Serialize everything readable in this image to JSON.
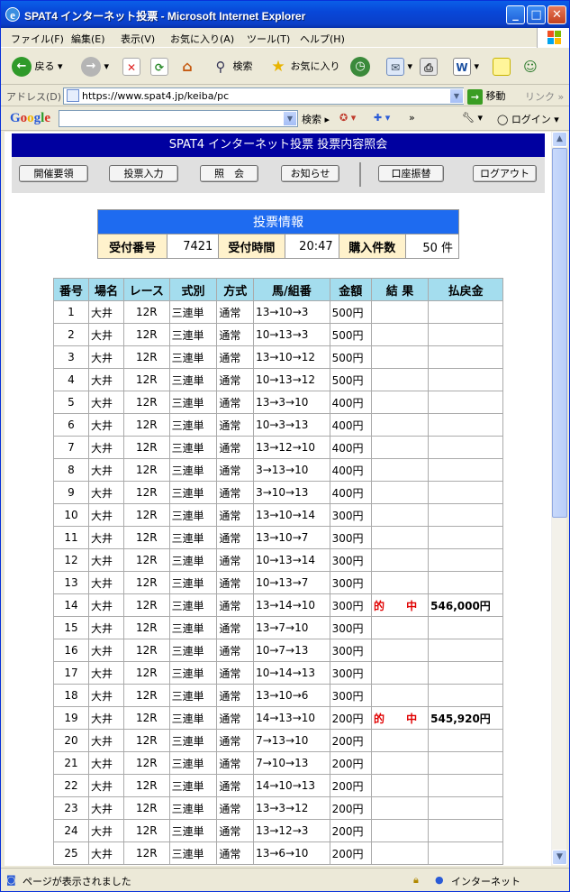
{
  "window": {
    "title": "SPAT4 インターネット投票 - Microsoft Internet Explorer"
  },
  "menu": [
    "ファイル(F)",
    "編集(E)",
    "表示(V)",
    "お気に入り(A)",
    "ツール(T)",
    "ヘルプ(H)"
  ],
  "toolbar": {
    "back": "戻る",
    "search": "検索",
    "favorites": "お気に入り"
  },
  "address": {
    "label": "アドレス(D)",
    "url": "https://www.spat4.jp/keiba/pc",
    "go": "移動",
    "links": "リンク"
  },
  "google": {
    "logo": "Google",
    "search": "検索",
    "login": "ログイン"
  },
  "page": {
    "header": "SPAT4 インターネット投票 投票内容照会",
    "nav": [
      "開催要領",
      "投票入力",
      "照　会",
      "お知らせ",
      "口座振替",
      "ログアウト"
    ]
  },
  "info": {
    "title": "投票情報",
    "receipt_label": "受付番号",
    "receipt_value": "7421",
    "time_label": "受付時間",
    "time_value": "20:47",
    "count_label": "購入件数",
    "count_value": "50 件"
  },
  "table": {
    "headers": [
      "番号",
      "場名",
      "レース",
      "式別",
      "方式",
      "馬/組番",
      "金額",
      "結 果",
      "払戻金"
    ],
    "rows": [
      [
        "1",
        "大井",
        "12R",
        "三連単",
        "通常",
        "13→10→3",
        "500円",
        "",
        ""
      ],
      [
        "2",
        "大井",
        "12R",
        "三連単",
        "通常",
        "10→13→3",
        "500円",
        "",
        ""
      ],
      [
        "3",
        "大井",
        "12R",
        "三連単",
        "通常",
        "13→10→12",
        "500円",
        "",
        ""
      ],
      [
        "4",
        "大井",
        "12R",
        "三連単",
        "通常",
        "10→13→12",
        "500円",
        "",
        ""
      ],
      [
        "5",
        "大井",
        "12R",
        "三連単",
        "通常",
        "13→3→10",
        "400円",
        "",
        ""
      ],
      [
        "6",
        "大井",
        "12R",
        "三連単",
        "通常",
        "10→3→13",
        "400円",
        "",
        ""
      ],
      [
        "7",
        "大井",
        "12R",
        "三連単",
        "通常",
        "13→12→10",
        "400円",
        "",
        ""
      ],
      [
        "8",
        "大井",
        "12R",
        "三連単",
        "通常",
        "3→13→10",
        "400円",
        "",
        ""
      ],
      [
        "9",
        "大井",
        "12R",
        "三連単",
        "通常",
        "3→10→13",
        "400円",
        "",
        ""
      ],
      [
        "10",
        "大井",
        "12R",
        "三連単",
        "通常",
        "13→10→14",
        "300円",
        "",
        ""
      ],
      [
        "11",
        "大井",
        "12R",
        "三連単",
        "通常",
        "13→10→7",
        "300円",
        "",
        ""
      ],
      [
        "12",
        "大井",
        "12R",
        "三連単",
        "通常",
        "10→13→14",
        "300円",
        "",
        ""
      ],
      [
        "13",
        "大井",
        "12R",
        "三連単",
        "通常",
        "10→13→7",
        "300円",
        "",
        ""
      ],
      [
        "14",
        "大井",
        "12R",
        "三連単",
        "通常",
        "13→14→10",
        "300円",
        "的 中",
        "546,000円"
      ],
      [
        "15",
        "大井",
        "12R",
        "三連単",
        "通常",
        "13→7→10",
        "300円",
        "",
        ""
      ],
      [
        "16",
        "大井",
        "12R",
        "三連単",
        "通常",
        "10→7→13",
        "300円",
        "",
        ""
      ],
      [
        "17",
        "大井",
        "12R",
        "三連単",
        "通常",
        "10→14→13",
        "300円",
        "",
        ""
      ],
      [
        "18",
        "大井",
        "12R",
        "三連単",
        "通常",
        "13→10→6",
        "300円",
        "",
        ""
      ],
      [
        "19",
        "大井",
        "12R",
        "三連単",
        "通常",
        "14→13→10",
        "200円",
        "的 中",
        "545,920円"
      ],
      [
        "20",
        "大井",
        "12R",
        "三連単",
        "通常",
        "7→13→10",
        "200円",
        "",
        ""
      ],
      [
        "21",
        "大井",
        "12R",
        "三連単",
        "通常",
        "7→10→13",
        "200円",
        "",
        ""
      ],
      [
        "22",
        "大井",
        "12R",
        "三連単",
        "通常",
        "14→10→13",
        "200円",
        "",
        ""
      ],
      [
        "23",
        "大井",
        "12R",
        "三連単",
        "通常",
        "13→3→12",
        "200円",
        "",
        ""
      ],
      [
        "24",
        "大井",
        "12R",
        "三連単",
        "通常",
        "13→12→3",
        "200円",
        "",
        ""
      ],
      [
        "25",
        "大井",
        "12R",
        "三連単",
        "通常",
        "13→6→10",
        "200円",
        "",
        ""
      ]
    ]
  },
  "status": {
    "text": "ページが表示されました",
    "zone": "インターネット"
  }
}
